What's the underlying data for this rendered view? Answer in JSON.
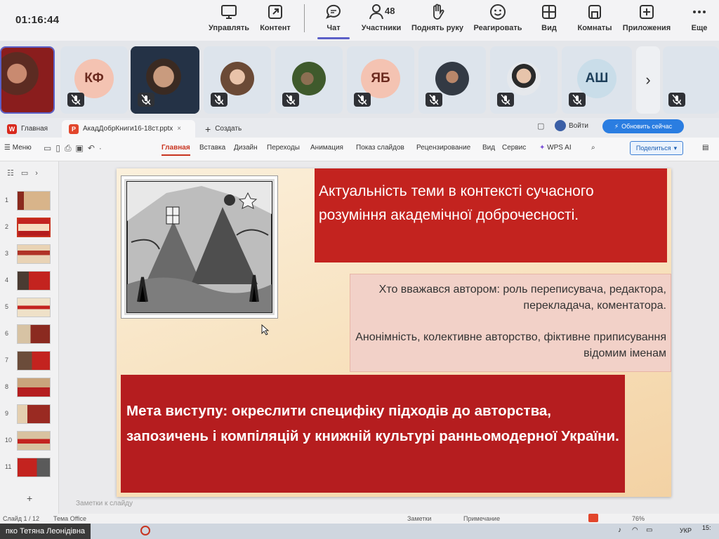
{
  "meeting": {
    "time": "01:16:44",
    "toolbar": [
      {
        "id": "manage",
        "label": "Управлять",
        "icon": "manage-screen-icon"
      },
      {
        "id": "content",
        "label": "Контент",
        "icon": "share-content-icon"
      },
      {
        "id": "chat",
        "label": "Чат",
        "icon": "chat-icon",
        "active": true
      },
      {
        "id": "people",
        "label": "Участники",
        "icon": "people-icon",
        "badge": "48"
      },
      {
        "id": "raise",
        "label": "Поднять руку",
        "icon": "raise-hand-icon"
      },
      {
        "id": "react",
        "label": "Реагировать",
        "icon": "react-smile-icon"
      },
      {
        "id": "view",
        "label": "Вид",
        "icon": "view-grid-icon"
      },
      {
        "id": "rooms",
        "label": "Комнаты",
        "icon": "breakout-rooms-icon"
      },
      {
        "id": "apps",
        "label": "Приложения",
        "icon": "apps-plus-icon"
      },
      {
        "id": "more",
        "label": "Еще",
        "icon": "more-dots-icon"
      }
    ],
    "participants": [
      {
        "kind": "video",
        "initials": ""
      },
      {
        "kind": "initials",
        "initials": "КФ",
        "color": "#f4c3b2"
      },
      {
        "kind": "video",
        "initials": ""
      },
      {
        "kind": "photo",
        "initials": ""
      },
      {
        "kind": "photo",
        "initials": ""
      },
      {
        "kind": "initials",
        "initials": "ЯБ",
        "color": "#f4c3b2"
      },
      {
        "kind": "photo",
        "initials": ""
      },
      {
        "kind": "photo",
        "initials": ""
      },
      {
        "kind": "initials",
        "initials": "АШ",
        "color": "#c9dde9"
      }
    ],
    "next_arrow": "›"
  },
  "wps": {
    "tabs": {
      "home": "Главная",
      "doc": "АкадДобрКниги16-18ст.pptx",
      "create": "Создать",
      "login": "Войти",
      "update": "Обновить сейчас"
    },
    "ribbon": {
      "menu": "Меню",
      "items": [
        "Главная",
        "Вставка",
        "Дизайн",
        "Переходы",
        "Анимация",
        "Показ слайдов",
        "Рецензирование",
        "Вид",
        "Сервис"
      ],
      "wps_ai": "WPS AI",
      "share": "Поделиться"
    },
    "slides": {
      "numbers": [
        "1",
        "2",
        "3",
        "4",
        "5",
        "6",
        "7",
        "8",
        "9",
        "10",
        "11"
      ],
      "selected_index": 2
    },
    "slide": {
      "title": "Актуальність теми в контексті сучасного розуміння академічної доброчесності.",
      "points": [
        "Хто вважався автором: роль переписувача, редактора, перекладача, коментатора.",
        "Анонімність, колективне авторство, фіктивне приписування відомим іменам"
      ],
      "goal": "Мета виступу: окреслити специфіку підходів до авторства, запозичень і компіляцій у книжній культурі ранньомодерної України."
    },
    "notes_placeholder": "Заметки к слайду",
    "status": {
      "slide_count": "Слайд 1 / 12",
      "theme": "Тема Office",
      "notes": "Заметки",
      "comments": "Примечание",
      "zoom": "76%"
    }
  },
  "taskbar": {
    "user_name": "пко Тетяна Леонідівна",
    "lang": "УКР",
    "time": "15:"
  },
  "colors": {
    "title_box": "#c3231f",
    "goal_box": "#b51d1f",
    "points_box": "#f2d1c8",
    "accent_teams": "#5b5fc7",
    "accent_wps": "#c8331f"
  }
}
